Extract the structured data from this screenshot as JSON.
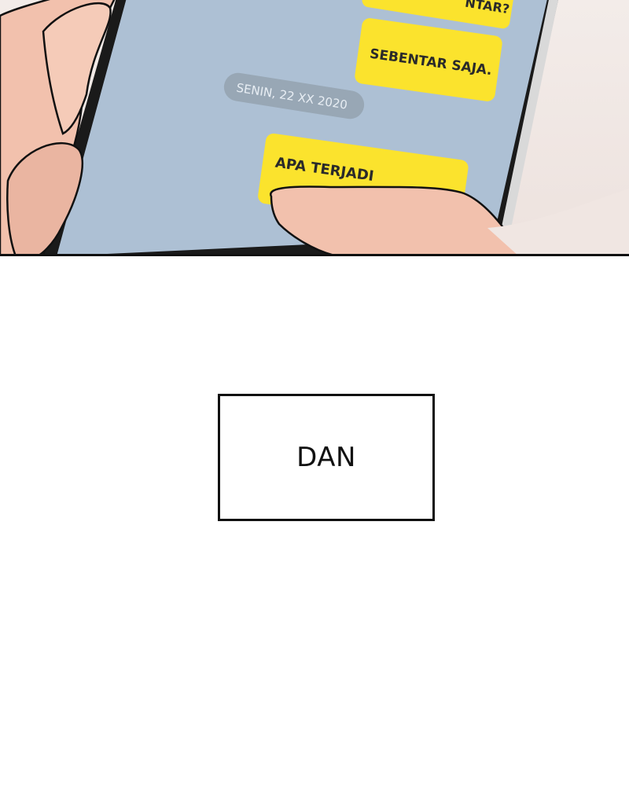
{
  "chat": {
    "top_bubble_partial": "NTAR?",
    "bubble_1": "SEBENTAR SAJA.",
    "date_separator": "SENIN, 22 XX 2020",
    "bubble_2_partial": "APA TERJADI"
  },
  "caption": {
    "text": "DAN"
  },
  "colors": {
    "chat_background": "#adc0d4",
    "bubble_yellow": "#fbe32d",
    "date_pill": "#98a7b5",
    "skin": "#f2c1ad"
  }
}
